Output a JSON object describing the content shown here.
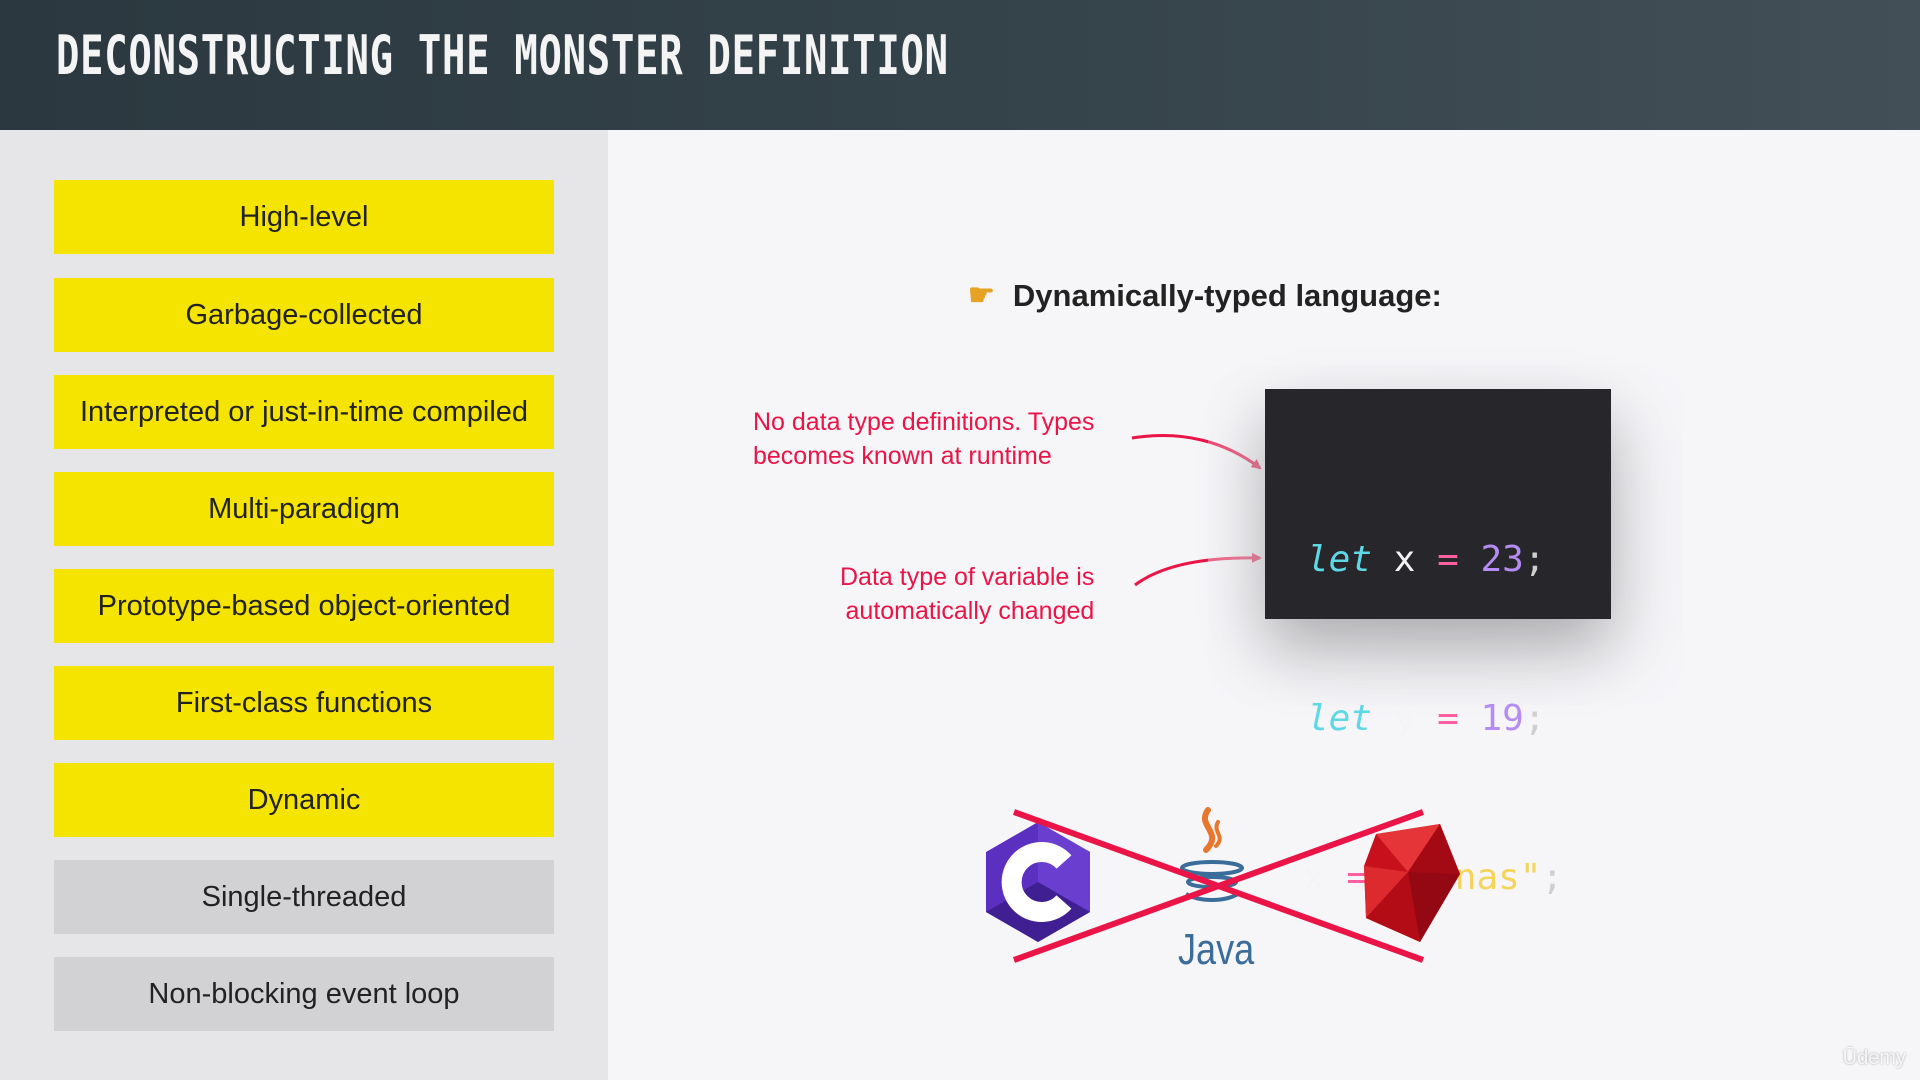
{
  "header": {
    "title": "Deconstructing the monster definition"
  },
  "sidebar": {
    "items": [
      {
        "label": "High-level",
        "state": "active"
      },
      {
        "label": "Garbage-collected",
        "state": "active"
      },
      {
        "label": "Interpreted or just-in-time compiled",
        "state": "active"
      },
      {
        "label": "Multi-paradigm",
        "state": "active"
      },
      {
        "label": "Prototype-based object-oriented",
        "state": "active"
      },
      {
        "label": "First-class functions",
        "state": "active"
      },
      {
        "label": "Dynamic",
        "state": "active"
      },
      {
        "label": "Single-threaded",
        "state": "inactive"
      },
      {
        "label": "Non-blocking event loop",
        "state": "inactive"
      }
    ]
  },
  "main": {
    "subtitle": "Dynamically-typed language:",
    "subtitle_icon": "pointing-hand-icon",
    "annotations": [
      "No data type definitions. Types\nbecomes known at runtime",
      "Data type of variable is\nautomatically changed"
    ],
    "code": {
      "line1": {
        "keyword": "let",
        "name": "x",
        "op": "=",
        "value": "23",
        "end": ";"
      },
      "line2": {
        "keyword": "let",
        "name": "y",
        "op": "=",
        "value": "19",
        "end": ";"
      },
      "line3": {
        "name": "x",
        "op": "=",
        "value": "\"Jonas\"",
        "end": ";"
      }
    },
    "languages": {
      "java_label": "Java",
      "logos": [
        "csharp-logo",
        "java-logo",
        "ruby-logo"
      ],
      "crossed_out": true
    }
  },
  "watermark": "Ūdemy",
  "colors": {
    "header_bg": "#2b383f",
    "sidebar_bg": "#e6e5e8",
    "active_item": "#f5e400",
    "inactive_item": "#d2d1d4",
    "annotation": "#ea1447",
    "code_bg": "#26262b",
    "cross": "#ea1447"
  }
}
